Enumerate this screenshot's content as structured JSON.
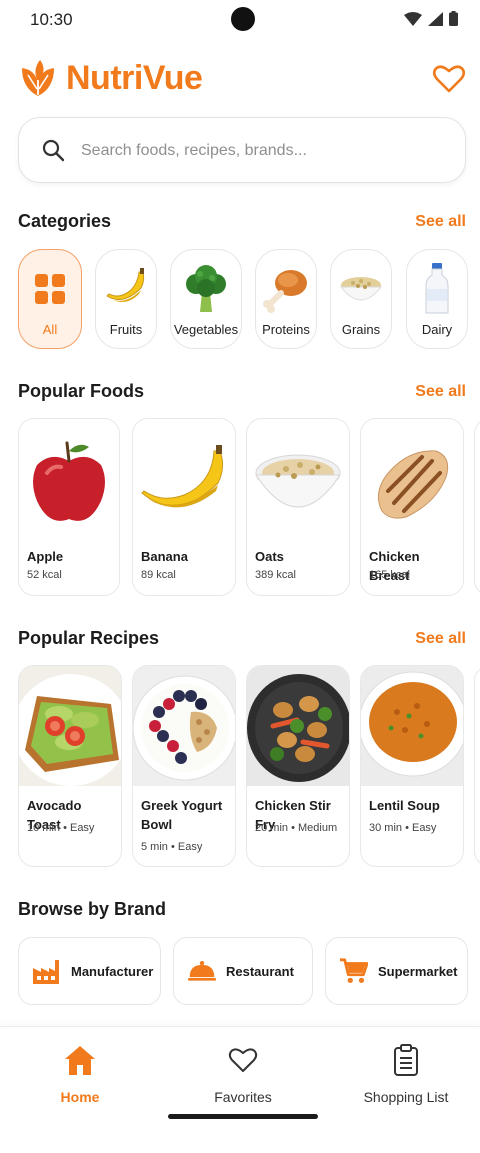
{
  "status_bar": {
    "time": "10:30"
  },
  "app": {
    "title": "NutriVue",
    "accent": "#f07a1c"
  },
  "search": {
    "placeholder": "Search foods, recipes, brands..."
  },
  "categories": {
    "title": "Categories",
    "see_all": "See all",
    "items": [
      {
        "label": "All",
        "icon": "grid-icon",
        "active": true
      },
      {
        "label": "Fruits",
        "icon": "banana-icon"
      },
      {
        "label": "Vegetables",
        "icon": "broccoli-icon"
      },
      {
        "label": "Proteins",
        "icon": "chicken-leg-icon"
      },
      {
        "label": "Grains",
        "icon": "grain-bowl-icon"
      },
      {
        "label": "Dairy",
        "icon": "milk-bottle-icon"
      }
    ]
  },
  "popular_foods": {
    "title": "Popular Foods",
    "see_all": "See all",
    "items": [
      {
        "name": "Apple",
        "kcal": "52 kcal"
      },
      {
        "name": "Banana",
        "kcal": "89 kcal"
      },
      {
        "name": "Oats",
        "kcal": "389 kcal"
      },
      {
        "name": "Chicken Breast",
        "kcal": "165 kcal"
      }
    ]
  },
  "popular_recipes": {
    "title": "Popular Recipes",
    "see_all": "See all",
    "items": [
      {
        "name": "Avocado Toast",
        "meta": "10 min • Easy"
      },
      {
        "name": "Greek Yogurt Bowl",
        "meta": "5 min • Easy"
      },
      {
        "name": "Chicken Stir Fry",
        "meta": "20 min • Medium"
      },
      {
        "name": "Lentil Soup",
        "meta": "30 min • Easy"
      }
    ]
  },
  "brands": {
    "title": "Browse by Brand",
    "items": [
      {
        "label": "Manufacturer",
        "icon": "factory-icon"
      },
      {
        "label": "Restaurant",
        "icon": "cloche-icon"
      },
      {
        "label": "Supermarket",
        "icon": "cart-icon"
      }
    ]
  },
  "bottom_nav": {
    "items": [
      {
        "label": "Home",
        "icon": "home-icon",
        "active": true
      },
      {
        "label": "Favorites",
        "icon": "heart-icon"
      },
      {
        "label": "Shopping List",
        "icon": "clipboard-icon"
      }
    ]
  }
}
